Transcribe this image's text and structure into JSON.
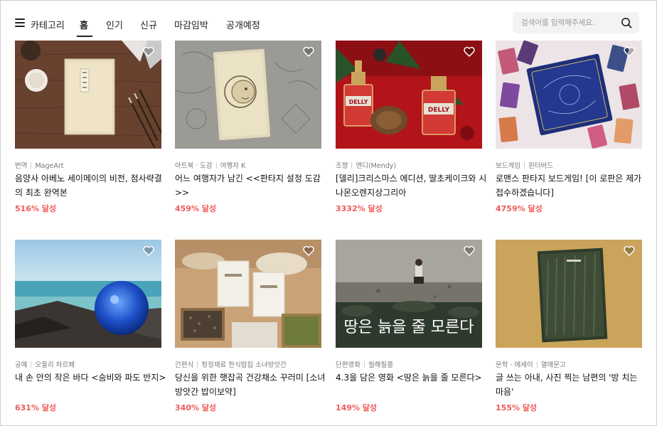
{
  "nav": {
    "category_label": "카테고리",
    "tabs": [
      {
        "label": "홈",
        "active": true
      },
      {
        "label": "인기"
      },
      {
        "label": "신규"
      },
      {
        "label": "마감임박"
      },
      {
        "label": "공개예정"
      }
    ]
  },
  "search": {
    "placeholder": "검색어를 입력해주세요.",
    "icon": "search-icon"
  },
  "colors": {
    "accent_rate": "#ef5a5a",
    "text": "#222222",
    "muted": "#777777",
    "search_bg": "#f2f3f4"
  },
  "projects": [
    {
      "category": "번역",
      "creator": "MageArt",
      "title": "음양사 아베노 세이메이의 비전, 점사략결의 최초 완역본",
      "rate": "516% 달성"
    },
    {
      "category": "아트북 · 도감",
      "creator": "여행자 K",
      "title": "어느 여행자가 남긴 <<판타지 설정 도감>>",
      "rate": "459% 달성"
    },
    {
      "category": "조향",
      "creator": "멘디(Mendy)",
      "title": "[델리]크리스마스 에디션, 딸초케이크와 시나몬오렌지상그리아",
      "rate": "3332% 달성"
    },
    {
      "category": "보드게임",
      "creator": "윈터버드",
      "title": "로맨스 판타지 보드게임! [이 로판은 제가 접수하겠습니다]",
      "rate": "4759% 달성"
    },
    {
      "category": "공예",
      "creator": "오들리 파르페",
      "title": "내 손 안의 작은 바다 <숨비와 파도 반지>",
      "rate": "631% 달성"
    },
    {
      "category": "간편식",
      "creator": "청정재료 한식밥집 소녀방앗간",
      "title": "당신을 위한 햇잡곡 건강채소 꾸러미 [소녀방앗간 밥이보약]",
      "rate": "340% 달성"
    },
    {
      "category": "단편영화",
      "creator": "월해필름",
      "title": "4.3을 담은 영화 <땅은 늙을 줄 모른다>",
      "rate": "149% 달성",
      "image_text": "땅은 늙을 줄 모른다"
    },
    {
      "category": "문학 · 에세이",
      "creator": "열매문고",
      "title": "글 쓰는 아내, 사진 찍는 남편의 '방 치는 마음'",
      "rate": "155% 달성"
    }
  ]
}
